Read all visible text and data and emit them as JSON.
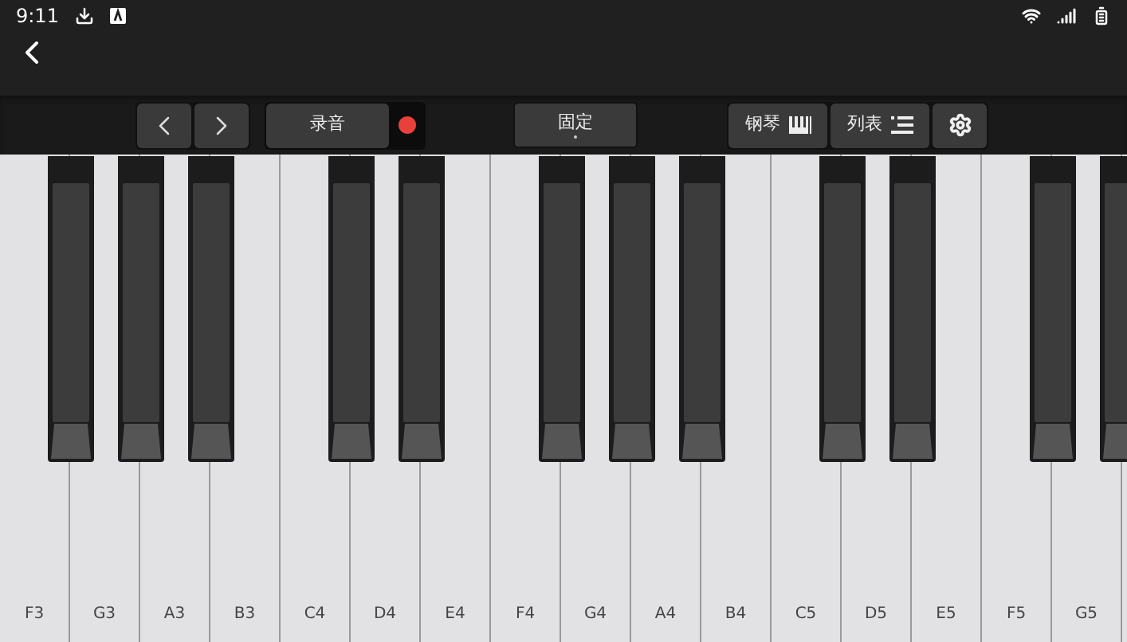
{
  "status_bar": {
    "time": "9:11"
  },
  "toolbar": {
    "record": {
      "label": "录音",
      "recording": true
    },
    "mode": {
      "label": "固定"
    },
    "instrument": {
      "label": "钢琴"
    },
    "list": {
      "label": "列表"
    }
  },
  "keys": [
    {
      "kind": "natural",
      "label": "F3"
    },
    {
      "kind": "sharp"
    },
    {
      "kind": "natural",
      "label": "G3"
    },
    {
      "kind": "sharp"
    },
    {
      "kind": "natural",
      "label": "A3"
    },
    {
      "kind": "sharp"
    },
    {
      "kind": "natural",
      "label": "B3"
    },
    {
      "kind": "natural",
      "label": "C4"
    },
    {
      "kind": "sharp"
    },
    {
      "kind": "natural",
      "label": "D4"
    },
    {
      "kind": "sharp"
    },
    {
      "kind": "natural",
      "label": "E4"
    },
    {
      "kind": "natural",
      "label": "F4"
    },
    {
      "kind": "sharp"
    },
    {
      "kind": "natural",
      "label": "G4"
    },
    {
      "kind": "sharp"
    },
    {
      "kind": "natural",
      "label": "A4"
    },
    {
      "kind": "sharp"
    },
    {
      "kind": "natural",
      "label": "B4"
    },
    {
      "kind": "natural",
      "label": "C5"
    },
    {
      "kind": "sharp"
    },
    {
      "kind": "natural",
      "label": "D5"
    },
    {
      "kind": "sharp"
    },
    {
      "kind": "natural",
      "label": "E5"
    },
    {
      "kind": "natural",
      "label": "F5"
    },
    {
      "kind": "sharp"
    },
    {
      "kind": "natural",
      "label": "G5"
    },
    {
      "kind": "sharp"
    }
  ]
}
